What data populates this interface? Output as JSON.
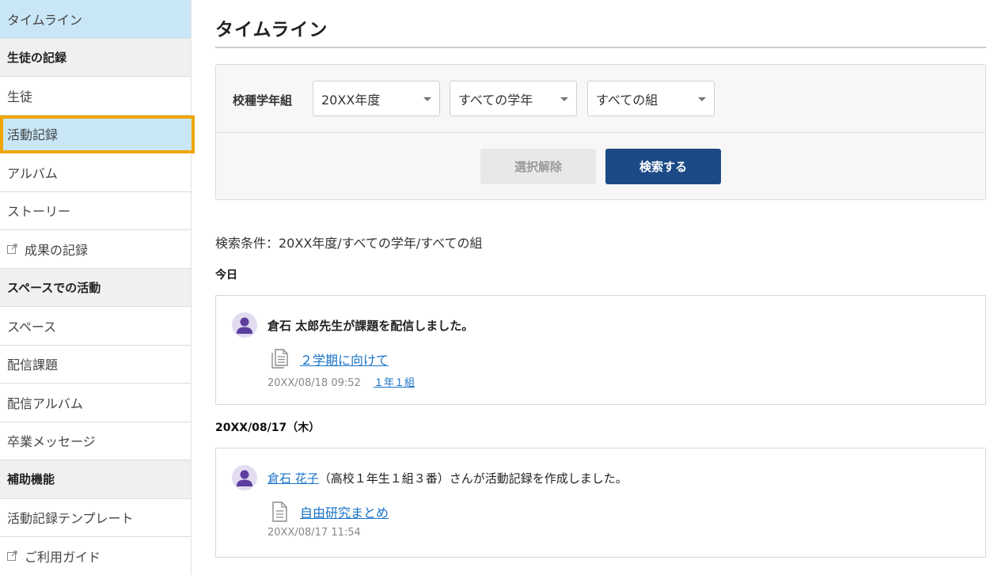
{
  "sidebar": {
    "items": [
      {
        "label": "タイムライン",
        "type": "item",
        "active": true
      },
      {
        "label": "生徒の記録",
        "type": "section"
      },
      {
        "label": "生徒",
        "type": "item"
      },
      {
        "label": "活動記録",
        "type": "item",
        "active": true,
        "highlighted": true
      },
      {
        "label": "アルバム",
        "type": "item"
      },
      {
        "label": "ストーリー",
        "type": "item"
      },
      {
        "label": "成果の記録",
        "type": "item",
        "icon": "external-link-icon"
      },
      {
        "label": "スペースでの活動",
        "type": "section"
      },
      {
        "label": "スペース",
        "type": "item"
      },
      {
        "label": "配信課題",
        "type": "item"
      },
      {
        "label": "配信アルバム",
        "type": "item"
      },
      {
        "label": "卒業メッセージ",
        "type": "item"
      },
      {
        "label": "補助機能",
        "type": "section"
      },
      {
        "label": "活動記録テンプレート",
        "type": "item"
      },
      {
        "label": "ご利用ガイド",
        "type": "item",
        "icon": "external-link-icon"
      }
    ]
  },
  "page": {
    "title": "タイムライン"
  },
  "filter": {
    "label": "校種学年組",
    "year_select": "20XX年度",
    "grade_select": "すべての学年",
    "class_select": "すべての組",
    "clear_button": "選択解除",
    "search_button": "検索する"
  },
  "conditions": "検索条件：20XX年度/すべての学年/すべての組",
  "timeline": [
    {
      "date_heading": "今日",
      "entry": {
        "message": "倉石 太郎先生が課題を配信しました。",
        "link_text": "２学期に向けて",
        "timestamp": "20XX/08/18 09:52",
        "class_link": "１年１組",
        "icon": "assignment-document-icon"
      }
    },
    {
      "date_heading": "20XX/08/17（木）",
      "entry": {
        "author_link": "倉石 花子",
        "message_suffix": "（高校１年生１組３番）さんが活動記録を作成しました。",
        "link_text": "自由研究まとめ",
        "timestamp": "20XX/08/17 11:54",
        "icon": "document-icon"
      }
    }
  ],
  "colors": {
    "active_bg": "#c8e6f5",
    "highlight_border": "#f0a500",
    "primary_button": "#1c4a87",
    "link": "#1a73c8",
    "avatar": "#5b3e9e"
  }
}
